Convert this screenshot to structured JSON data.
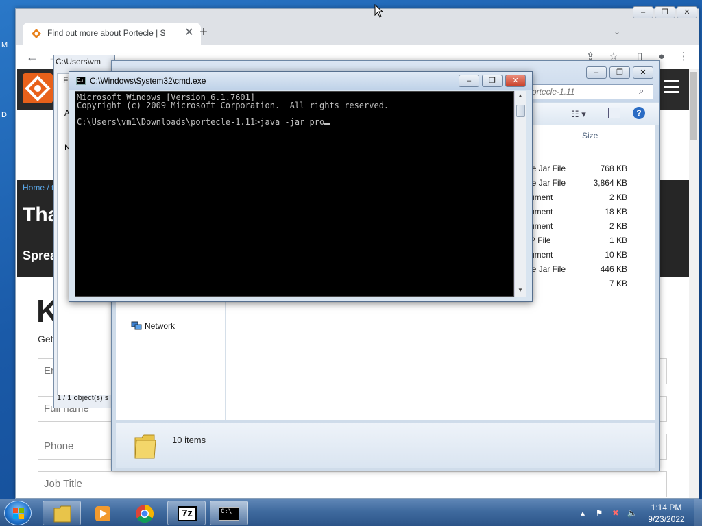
{
  "desktop": {
    "edge_m": "M",
    "edge_d": "D"
  },
  "chrome": {
    "tab_title": "Find out more about Portecle | S",
    "tab_close": "✕",
    "new_tab": "+",
    "tab_dropdown": "⌄",
    "win_minimize": "–",
    "win_restore": "❐",
    "win_close": "✕",
    "back": "←",
    "forward": "→"
  },
  "website": {
    "breadcrumb": "Home / t",
    "hero_title": "Tha",
    "hero_subtitle": "Sprea",
    "big_letter": "K",
    "intro": "Get",
    "fields": [
      {
        "placeholder": "Em"
      },
      {
        "placeholder": "Full name"
      },
      {
        "placeholder": "Phone"
      },
      {
        "placeholder": "Job Title"
      }
    ]
  },
  "zip_window": {
    "title": "C:\\Users\\vm",
    "menu_item": "Fi",
    "row_a": "A",
    "col_name": "N",
    "status": "1 / 1 object(s) s"
  },
  "explorer": {
    "address_text": "ortecle-1.11",
    "col_size": "Size",
    "partial_r": "r",
    "rows": [
      {
        "type": "le Jar File",
        "size": "768 KB"
      },
      {
        "type": "le Jar File",
        "size": "3,864 KB"
      },
      {
        "type": "ument",
        "size": "2 KB"
      },
      {
        "type": "ument",
        "size": "18 KB"
      },
      {
        "type": "ument",
        "size": "2 KB"
      },
      {
        "type": "P File",
        "size": "1 KB"
      },
      {
        "type": "ument",
        "size": "10 KB"
      },
      {
        "type": "le Jar File",
        "size": "446 KB"
      },
      {
        "type": "",
        "size": "7 KB"
      }
    ],
    "nav_network": "Network",
    "details_count": "10 items",
    "btn_minimize": "–",
    "btn_maximize": "❐",
    "btn_close": "✕"
  },
  "cmd": {
    "title": "C:\\Windows\\System32\\cmd.exe",
    "btn_minimize": "–",
    "btn_maximize": "❐",
    "btn_close": "✕",
    "line1": "Microsoft Windows [Version 6.1.7601]",
    "line2": "Copyright (c) 2009 Microsoft Corporation.  All rights reserved.",
    "line3": "",
    "line4": "C:\\Users\\vm1\\Downloads\\portecle-1.11>java -jar pro"
  },
  "taskbar": {
    "time": "1:14 PM",
    "date": "9/23/2022",
    "zip_label": "7z",
    "cmd_label": "C:\\_"
  }
}
